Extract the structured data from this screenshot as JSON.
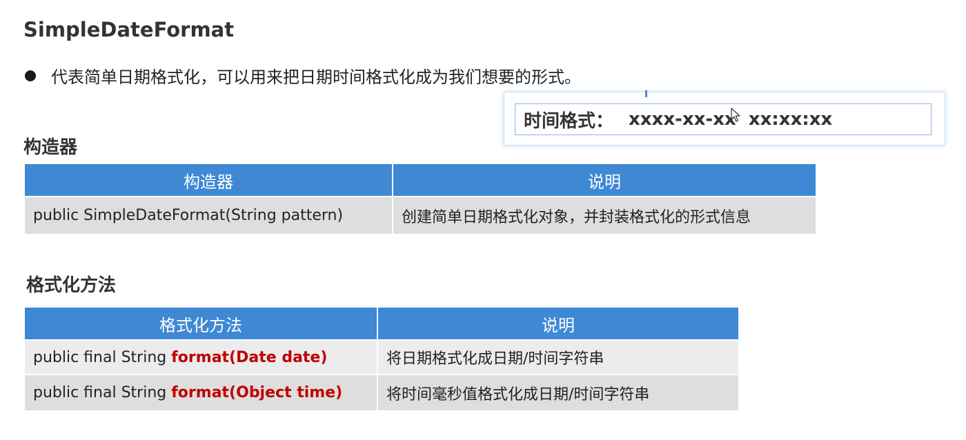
{
  "title": "SimpleDateFormat",
  "bullet": "代表简单日期格式化，可以用来把日期时间格式化成为我们想要的形式。",
  "popup": {
    "label": "时间格式：",
    "value": "xxxx-xx-xx  xx:xx:xx"
  },
  "constructor_section": {
    "heading": "构造器",
    "headers": [
      "构造器",
      "说明"
    ],
    "rows": [
      {
        "signature": "public SimpleDateFormat(String pattern)",
        "desc": "创建简单日期格式化对象，并封装格式化的形式信息"
      }
    ]
  },
  "format_section": {
    "heading": "格式化方法",
    "headers": [
      "格式化方法",
      "说明"
    ],
    "rows": [
      {
        "prefix": "public final String ",
        "method": "format(Date date)",
        "desc": "将日期格式化成日期/时间字符串"
      },
      {
        "prefix": "public final String ",
        "method": "format(Object time)",
        "desc": "将时间毫秒值格式化成日期/时间字符串"
      }
    ]
  },
  "colors": {
    "header_bg": "#3f88d4",
    "method_highlight": "#c00000",
    "row_light": "#ececec",
    "row_dark": "#dedede"
  },
  "icons": {
    "bullet": "filled-circle",
    "cursor": "mouse-pointer-arrow"
  }
}
